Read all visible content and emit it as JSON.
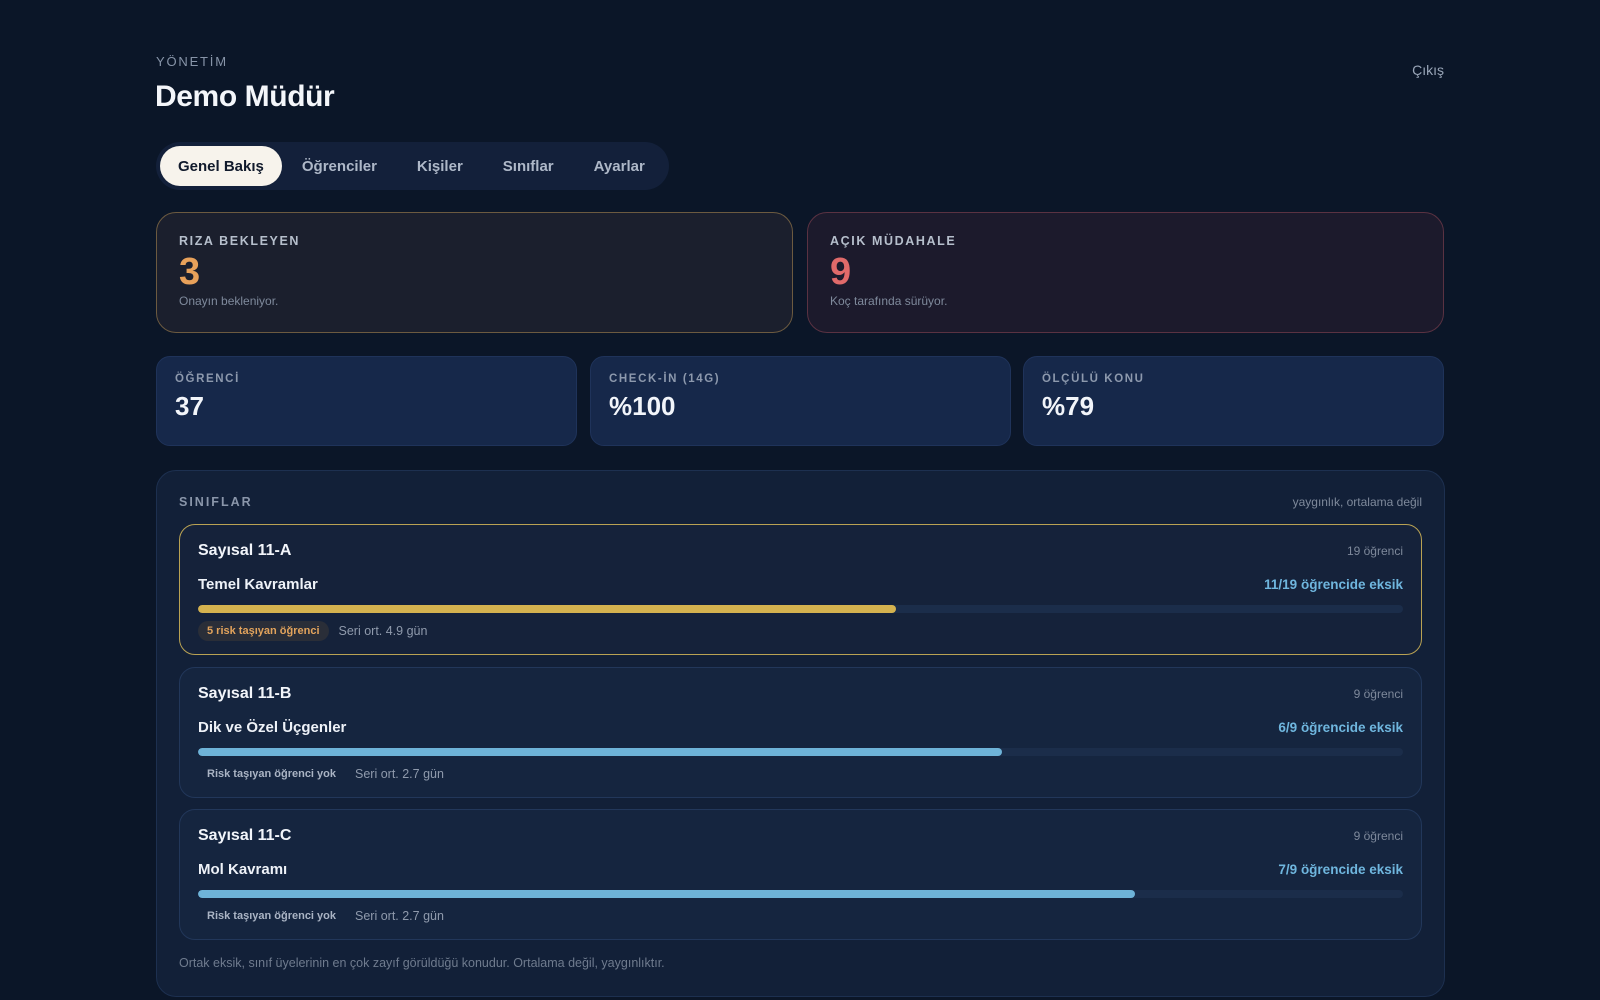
{
  "header": {
    "eyebrow": "YÖNETİM",
    "title": "Demo Müdür",
    "logout_label": "Çıkış"
  },
  "tabs": [
    {
      "label": "Genel Bakış",
      "active": true
    },
    {
      "label": "Öğrenciler",
      "active": false
    },
    {
      "label": "Kişiler",
      "active": false
    },
    {
      "label": "Sınıflar",
      "active": false
    },
    {
      "label": "Ayarlar",
      "active": false
    }
  ],
  "alerts": {
    "consent": {
      "label": "RIZA BEKLEYEN",
      "value": "3",
      "sub": "Onayın bekleniyor.",
      "color": "#e8a15a"
    },
    "intervention": {
      "label": "AÇIK MÜDAHALE",
      "value": "9",
      "sub": "Koç tarafında sürüyor.",
      "color": "#e06a6a"
    }
  },
  "stats": [
    {
      "label": "ÖĞRENCİ",
      "value": "37"
    },
    {
      "label": "CHECK-İN (14G)",
      "value": "%100"
    },
    {
      "label": "ÖLÇÜLÜ KONU",
      "value": "%79"
    }
  ],
  "classes_panel": {
    "title": "SINIFLAR",
    "hint": "yaygınlık, ortalama değil",
    "footnote": "Ortak eksik, sınıf üyelerinin en çok zayıf görüldüğü konudur. Ortalama değil, yaygınlıktır.",
    "classes": [
      {
        "name": "Sayısal 11-A",
        "student_count": "19 öğrenci",
        "topic": "Temel Kavramlar",
        "gap_text": "11/19 öğrencide eksik",
        "gap_fraction": 0.579,
        "risk_text": "5 risk taşıyan öğrenci",
        "has_risk": true,
        "streak": "Seri ort. 4.9 gün"
      },
      {
        "name": "Sayısal 11-B",
        "student_count": "9 öğrenci",
        "topic": "Dik ve Özel Üçgenler",
        "gap_text": "6/9 öğrencide eksik",
        "gap_fraction": 0.667,
        "risk_text": "Risk taşıyan öğrenci yok",
        "has_risk": false,
        "streak": "Seri ort. 2.7 gün"
      },
      {
        "name": "Sayısal 11-C",
        "student_count": "9 öğrenci",
        "topic": "Mol Kavramı",
        "gap_text": "7/9 öğrencide eksik",
        "gap_fraction": 0.778,
        "risk_text": "Risk taşıyan öğrenci yok",
        "has_risk": false,
        "streak": "Seri ort. 2.7 gün"
      }
    ]
  }
}
